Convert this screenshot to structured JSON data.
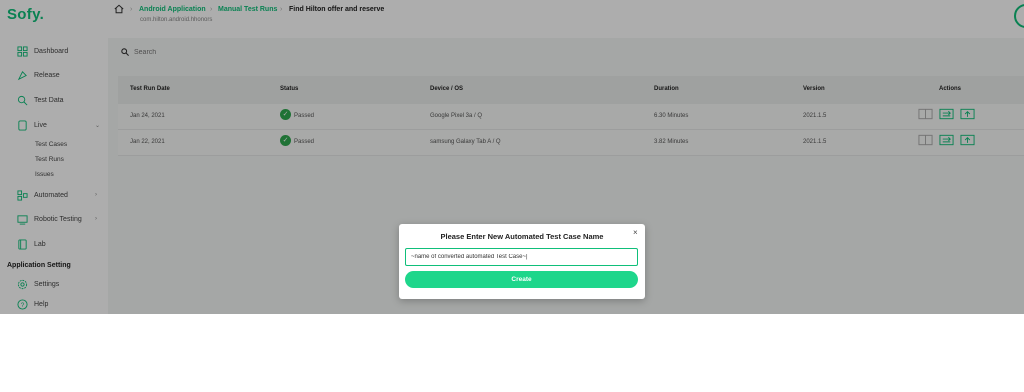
{
  "app": {
    "logo": "Sofy."
  },
  "colors": {
    "accent": "#0fbf7a",
    "passed": "#2fa84f",
    "create_button": "#1ed68b"
  },
  "sidebar": {
    "items": [
      {
        "label": "Dashboard",
        "icon": "dashboard-icon"
      },
      {
        "label": "Release",
        "icon": "release-icon"
      },
      {
        "label": "Test Data",
        "icon": "test-data-icon"
      },
      {
        "label": "Live",
        "icon": "live-icon",
        "chevron": "⌄"
      },
      {
        "label": "Automated",
        "icon": "automated-icon",
        "chevron": "›"
      },
      {
        "label": "Robotic Testing",
        "icon": "robotic-testing-icon",
        "chevron": "›"
      },
      {
        "label": "Lab",
        "icon": "lab-icon"
      }
    ],
    "live_subitems": [
      "Test Cases",
      "Test Runs",
      "Issues"
    ],
    "section_label": "Application Setting",
    "settings_items": [
      {
        "label": "Settings",
        "icon": "settings-icon"
      },
      {
        "label": "Help",
        "icon": "help-icon"
      }
    ]
  },
  "header": {
    "breadcrumbs": [
      "Android Application",
      "Manual Test Runs",
      "Find Hilton offer and reserve"
    ],
    "separator": "›",
    "subtitle": "com.hilton.android.hhonors"
  },
  "search": {
    "placeholder": "Search"
  },
  "table": {
    "columns": [
      "Test Run Date",
      "Status",
      "Device / OS",
      "Duration",
      "Version",
      "Actions"
    ],
    "rows": [
      {
        "date": "Jan 24, 2021",
        "status": "Passed",
        "device": "Google Pixel 3a / Q",
        "duration": "6.30 Minutes",
        "version": "2021.1.5"
      },
      {
        "date": "Jan 22, 2021",
        "status": "Passed",
        "device": "samsung Galaxy Tab A / Q",
        "duration": "3.82 Minutes",
        "version": "2021.1.5"
      }
    ]
  },
  "modal": {
    "title": "Please Enter New Automated Test Case Name",
    "input_value": "~name of converted automated Test Case~|",
    "close": "×",
    "create_label": "Create"
  }
}
